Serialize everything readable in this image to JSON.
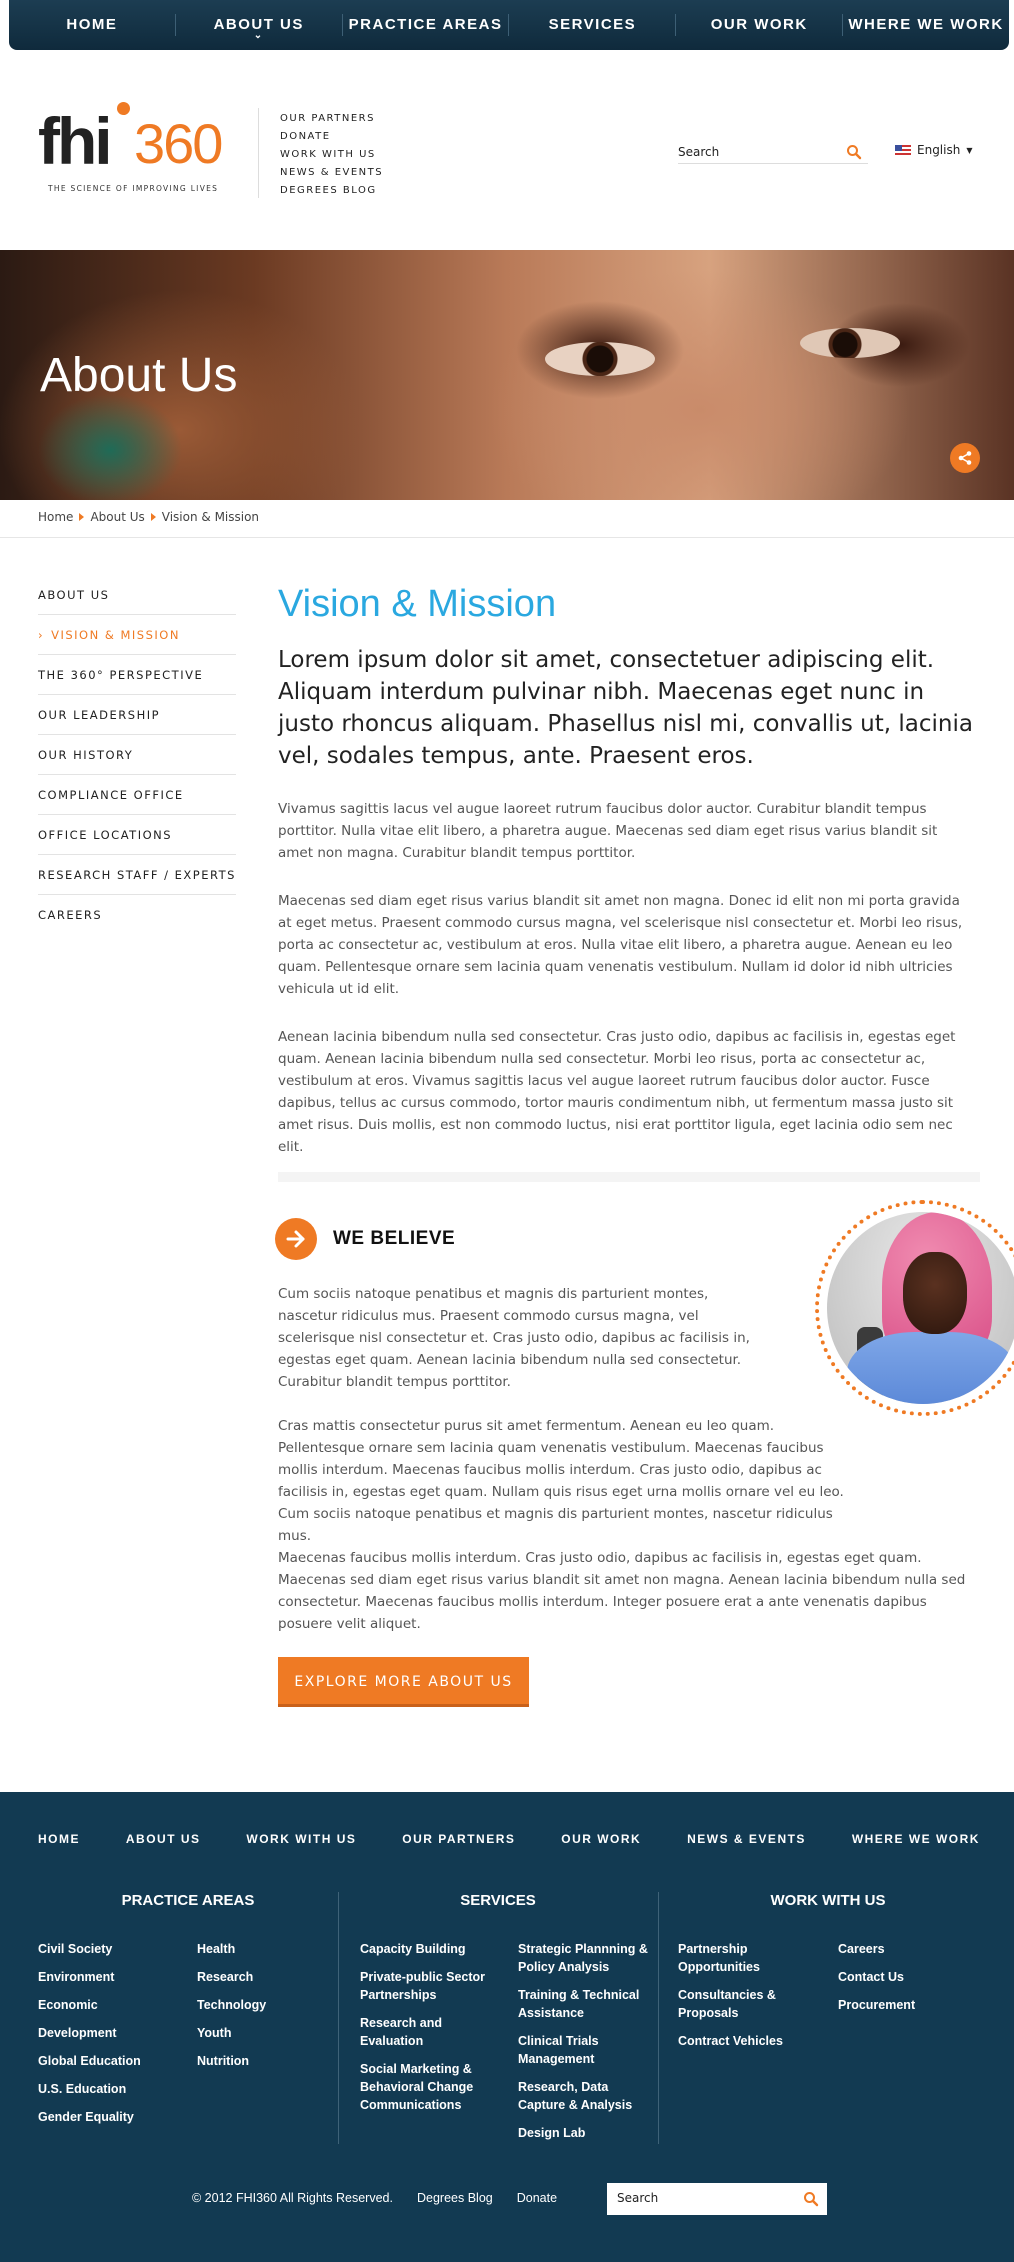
{
  "top_nav": [
    "HOME",
    "ABOUT US",
    "PRACTICE AREAS",
    "SERVICES",
    "OUR WORK",
    "WHERE WE WORK"
  ],
  "logo": {
    "fhi": "fhi",
    "num": "360",
    "tagline": "THE SCIENCE OF IMPROVING LIVES"
  },
  "sub_links": [
    "OUR PARTNERS",
    "DONATE",
    "WORK WITH US",
    "NEWS & EVENTS",
    "DEGREES BLOG"
  ],
  "search": {
    "placeholder": "Search"
  },
  "language": "English",
  "hero": {
    "title": "About Us"
  },
  "breadcrumb": [
    "Home",
    "About Us",
    "Vision & Mission"
  ],
  "side_menu": [
    {
      "label": "ABOUT US",
      "active": false
    },
    {
      "label": "VISION & MISSION",
      "active": true
    },
    {
      "label": "THE 360° PERSPECTIVE",
      "active": false
    },
    {
      "label": "OUR LEADERSHIP",
      "active": false
    },
    {
      "label": "OUR HISTORY",
      "active": false
    },
    {
      "label": "COMPLIANCE OFFICE",
      "active": false
    },
    {
      "label": "OFFICE LOCATIONS",
      "active": false
    },
    {
      "label": "RESEARCH STAFF / EXPERTS",
      "active": false
    },
    {
      "label": "CAREERS",
      "active": false
    }
  ],
  "main": {
    "title": "Vision & Mission",
    "lead": "Lorem ipsum dolor sit amet, consectetuer adipiscing elit. Aliquam interdum pulvinar nibh. Maecenas eget nunc in justo rhoncus aliquam. Phasellus nisl mi, convallis ut, lacinia vel, sodales tempus, ante. Praesent eros.",
    "paragraphs": [
      "Vivamus sagittis lacus vel augue laoreet rutrum faucibus dolor auctor. Curabitur blandit tempus porttitor. Nulla vitae elit libero, a pharetra augue. Maecenas sed diam eget risus varius blandit sit amet non magna. Curabitur blandit tempus porttitor.",
      "Maecenas sed diam eget risus varius blandit sit amet non magna. Donec id elit non mi porta gravida at eget metus. Praesent commodo cursus magna, vel scelerisque nisl consectetur et. Morbi leo risus, porta ac consectetur ac, vestibulum at eros. Nulla vitae elit libero, a pharetra augue. Aenean eu leo quam. Pellentesque ornare sem lacinia quam venenatis vestibulum. Nullam id dolor id nibh ultricies vehicula ut id elit.",
      "Aenean lacinia bibendum nulla sed consectetur. Cras justo odio, dapibus ac facilisis in, egestas eget quam. Aenean lacinia bibendum nulla sed consectetur. Morbi leo risus, porta ac consectetur ac, vestibulum at eros. Vivamus sagittis lacus vel augue laoreet rutrum faucibus dolor auctor. Fusce dapibus, tellus ac cursus commodo, tortor mauris condimentum nibh, ut fermentum massa justo sit amet risus. Duis mollis, est non commodo luctus, nisi erat porttitor ligula, eget lacinia odio sem nec elit."
    ]
  },
  "believe": {
    "title": "WE BELIEVE",
    "paragraphs": [
      "Cum sociis natoque penatibus et magnis dis parturient montes, nascetur ridiculus mus. Praesent commodo cursus magna, vel scelerisque nisl consectetur et. Cras justo odio, dapibus ac facilisis in, egestas eget quam. Aenean lacinia bibendum nulla sed consectetur. Curabitur blandit tempus porttitor.",
      "Cras mattis consectetur purus sit amet fermentum. Aenean eu leo quam. Pellentesque ornare sem lacinia quam venenatis vestibulum. Maecenas faucibus mollis interdum. Maecenas faucibus mollis interdum. Cras justo odio, dapibus ac facilisis in, egestas eget quam. Nullam quis risus eget urna mollis ornare vel eu leo. Cum sociis natoque penatibus et magnis dis parturient montes, nascetur ridiculus mus.",
      "Maecenas faucibus mollis interdum. Cras justo odio, dapibus ac facilisis in, egestas eget quam. Maecenas sed diam eget risus varius blandit sit amet non magna. Aenean lacinia bibendum nulla sed consectetur. Maecenas faucibus mollis interdum. Integer posuere erat a ante venenatis dapibus posuere velit aliquet."
    ]
  },
  "explore_button": "EXPLORE MORE ABOUT US",
  "footer": {
    "nav": [
      "HOME",
      "ABOUT US",
      "WORK WITH US",
      "OUR PARTNERS",
      "OUR WORK",
      "NEWS & EVENTS",
      "WHERE WE WORK"
    ],
    "practice_areas": {
      "title": "PRACTICE AREAS",
      "col1": [
        "Civil Society",
        "Environment",
        "Economic",
        "Development",
        "Global Education",
        "U.S. Education",
        "Gender Equality"
      ],
      "col2": [
        "Health",
        "Research",
        "Technology",
        "Youth",
        "Nutrition"
      ]
    },
    "services": {
      "title": "SERVICES",
      "col1": [
        "Capacity Building",
        "Private-public Sector Partnerships",
        "Research and Evaluation",
        "Social Marketing & Behavioral Change Communications"
      ],
      "col2": [
        "Strategic Plannning & Policy Analysis",
        "Training & Technical Assistance",
        "Clinical Trials Management",
        "Research, Data Capture & Analysis",
        "Design Lab"
      ]
    },
    "work_with_us": {
      "title": "WORK WITH US",
      "col1": [
        "Partnership Opportunities",
        "Consultancies & Proposals",
        "Contract Vehicles"
      ],
      "col2": [
        "Careers",
        "Contact Us",
        "Procurement"
      ]
    },
    "copyright": "© 2012 FHI360 All Rights Reserved.",
    "bottom_links": [
      "Degrees Blog",
      "Donate"
    ],
    "search_placeholder": "Search"
  },
  "colors": {
    "accent": "#ef7a24",
    "title_blue": "#2aa8e0",
    "navy": "#123a52"
  }
}
